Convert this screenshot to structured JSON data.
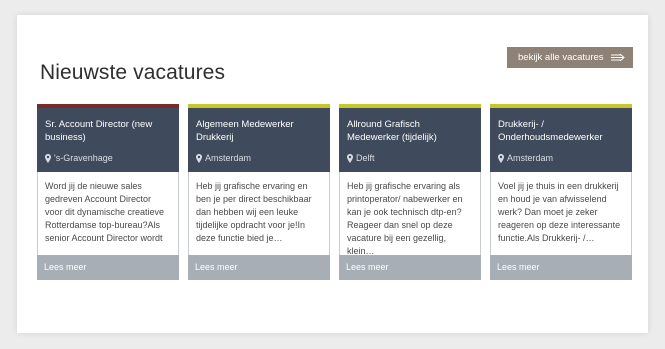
{
  "section": {
    "title": "Nieuwste vacatures",
    "all_button_label": "bekijk alle vacatures"
  },
  "colors": {
    "accent_dark_red": "#7a2a2a",
    "accent_lime": "#c6c82a",
    "card_header": "#3f4a5c",
    "card_footer": "#a8aeb5",
    "button": "#8e8277"
  },
  "cards": [
    {
      "accent": "#7a2a2a",
      "title": "Sr. Account Director (new business)",
      "location": "'s-Gravenhage",
      "snippet": "Word jij de nieuwe sales gedreven Account Director voor dit dynamische creatieve Rotterdamse top-bureau?Als senior Account Director wordt",
      "more_label": "Lees meer"
    },
    {
      "accent": "#c6c82a",
      "title": "Algemeen Medewerker Drukkerij",
      "location": "Amsterdam",
      "snippet": "Heb jij grafische ervaring en ben je per direct beschikbaar dan hebben wij een leuke tijdelijke opdracht voor je!In deze functie bied je…",
      "more_label": "Lees meer"
    },
    {
      "accent": "#c6c82a",
      "title": "Allround Grafisch Medewerker (tijdelijk)",
      "location": "Delft",
      "snippet": "Heb jij grafische ervaring als printoperator/ nabewerker en kan je ook technisch dtp-en? Reageer dan snel op deze vacature bij een gezellig, klein…",
      "more_label": "Lees meer"
    },
    {
      "accent": "#c6c82a",
      "title": "Drukkerij- / Onderhoudsmedewerker",
      "location": "Amsterdam",
      "snippet": "Voel jij je thuis in een drukkerij en houd je van afwisselend werk? Dan moet je zeker reageren op deze interessante functie.Als Drukkerij- /…",
      "more_label": "Lees meer"
    }
  ]
}
